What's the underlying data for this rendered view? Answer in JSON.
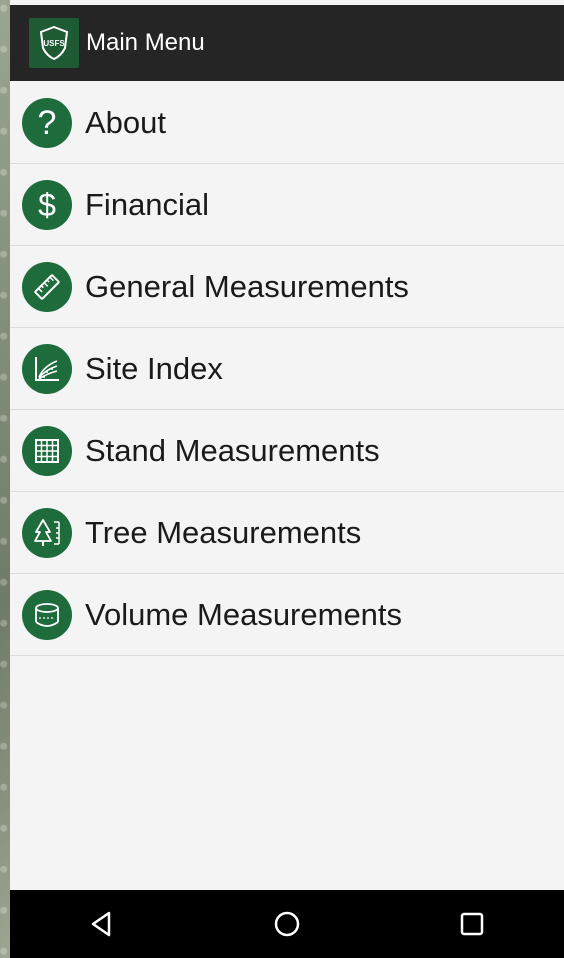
{
  "app_bar": {
    "title": "Main Menu",
    "logo_icon": "us-forest-service-shield-icon",
    "logo_text": "USFS"
  },
  "menu": {
    "items": [
      {
        "label": "About",
        "icon": "question-mark-icon",
        "glyph": "?"
      },
      {
        "label": "Financial",
        "icon": "dollar-sign-icon",
        "glyph": "$"
      },
      {
        "label": "General Measurements",
        "icon": "ruler-icon"
      },
      {
        "label": "Site Index",
        "icon": "chart-icon"
      },
      {
        "label": "Stand Measurements",
        "icon": "grid-icon"
      },
      {
        "label": "Tree Measurements",
        "icon": "tree-icon"
      },
      {
        "label": "Volume Measurements",
        "icon": "cylinder-icon"
      }
    ]
  },
  "nav_bar": {
    "back_icon": "back-triangle-icon",
    "home_icon": "home-circle-icon",
    "recents_icon": "recents-square-icon"
  },
  "colors": {
    "app_bar": "#252525",
    "icon_green": "#1e6b3c",
    "list_background": "#f4f4f4",
    "nav_bar": "#000000"
  }
}
